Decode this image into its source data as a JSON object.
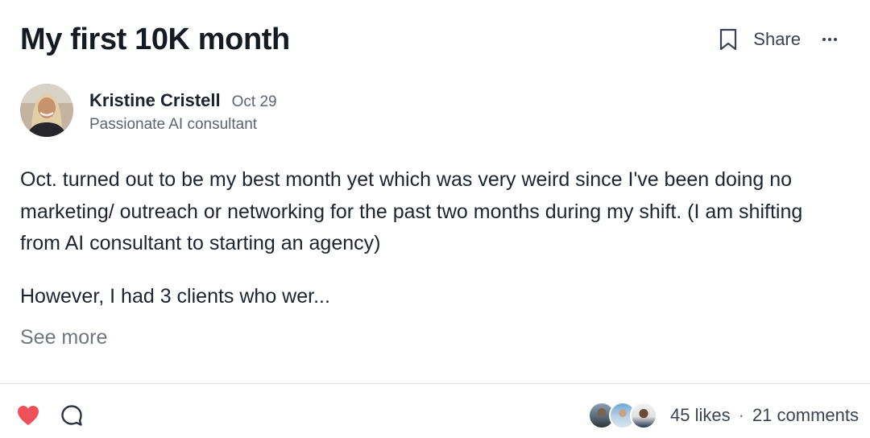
{
  "post": {
    "title": "My first 10K month",
    "author": {
      "name": "Kristine Cristell",
      "date": "Oct 29",
      "headline": "Passionate AI consultant"
    },
    "body": [
      "Oct. turned out to be my best month yet which was very weird since I've been doing no marketing/ outreach or networking for the past two months during my shift. (I am shifting from AI consultant to starting an agency)",
      "However, I had 3 clients who wer..."
    ],
    "see_more_label": "See more"
  },
  "header_actions": {
    "bookmark_icon": "bookmark-icon",
    "share_label": "Share",
    "more_icon": "more-horizontal-icon"
  },
  "footer": {
    "heart_icon": "heart-icon",
    "comment_icon": "comment-bubble-icon",
    "likes": "45 likes",
    "separator": "·",
    "comments": "21 comments"
  },
  "colors": {
    "heart": "#f0505a",
    "text_primary": "#1a1f2c",
    "text_secondary": "#5d6372",
    "divider": "#e4e6ea"
  }
}
